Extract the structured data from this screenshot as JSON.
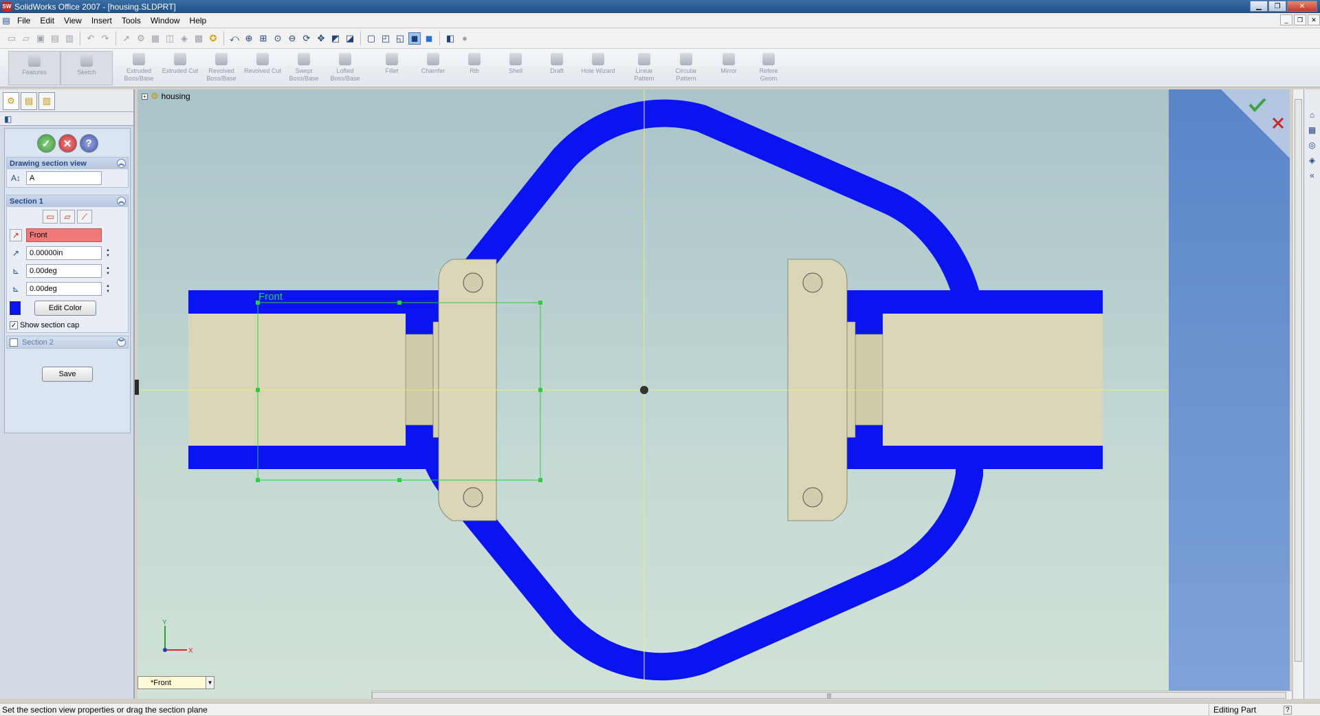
{
  "window": {
    "title": "SolidWorks Office 2007 - [housing.SLDPRT]",
    "app_icon": "SW"
  },
  "menu": [
    "File",
    "Edit",
    "View",
    "Insert",
    "Tools",
    "Window",
    "Help"
  ],
  "command_manager": [
    {
      "label": "Features"
    },
    {
      "label": "Sketch"
    },
    {
      "label": "Extruded Boss/Base"
    },
    {
      "label": "Extruded Cut"
    },
    {
      "label": "Revolved Boss/Base"
    },
    {
      "label": "Revolved Cut"
    },
    {
      "label": "Swept Boss/Base"
    },
    {
      "label": "Lofted Boss/Base"
    },
    {
      "label": "Fillet"
    },
    {
      "label": "Chamfer"
    },
    {
      "label": "Rib"
    },
    {
      "label": "Shell"
    },
    {
      "label": "Draft"
    },
    {
      "label": "Hole Wizard"
    },
    {
      "label": "Linear Pattern"
    },
    {
      "label": "Circular Pattern"
    },
    {
      "label": "Mirror"
    },
    {
      "label": "Refere Geom"
    }
  ],
  "property_manager": {
    "group1": {
      "title": "Drawing section view",
      "name_value": "A"
    },
    "section1": {
      "title": "Section 1",
      "plane": "Front",
      "offset": "0.00000in",
      "angle_x": "0.00deg",
      "angle_y": "0.00deg",
      "edit_color": "Edit Color",
      "show_cap": "Show section cap"
    },
    "section2": {
      "title": "Section 2"
    },
    "save": "Save"
  },
  "viewport": {
    "tree_item": "housing",
    "plane_label": "Front",
    "view_tab": "*Front",
    "axis_x": "X",
    "axis_y": "Y",
    "section_color": "#0a14f0",
    "solid_color": "#d9d7b8"
  },
  "status": {
    "message": "Set the section view properties or drag the section plane",
    "mode": "Editing Part"
  }
}
